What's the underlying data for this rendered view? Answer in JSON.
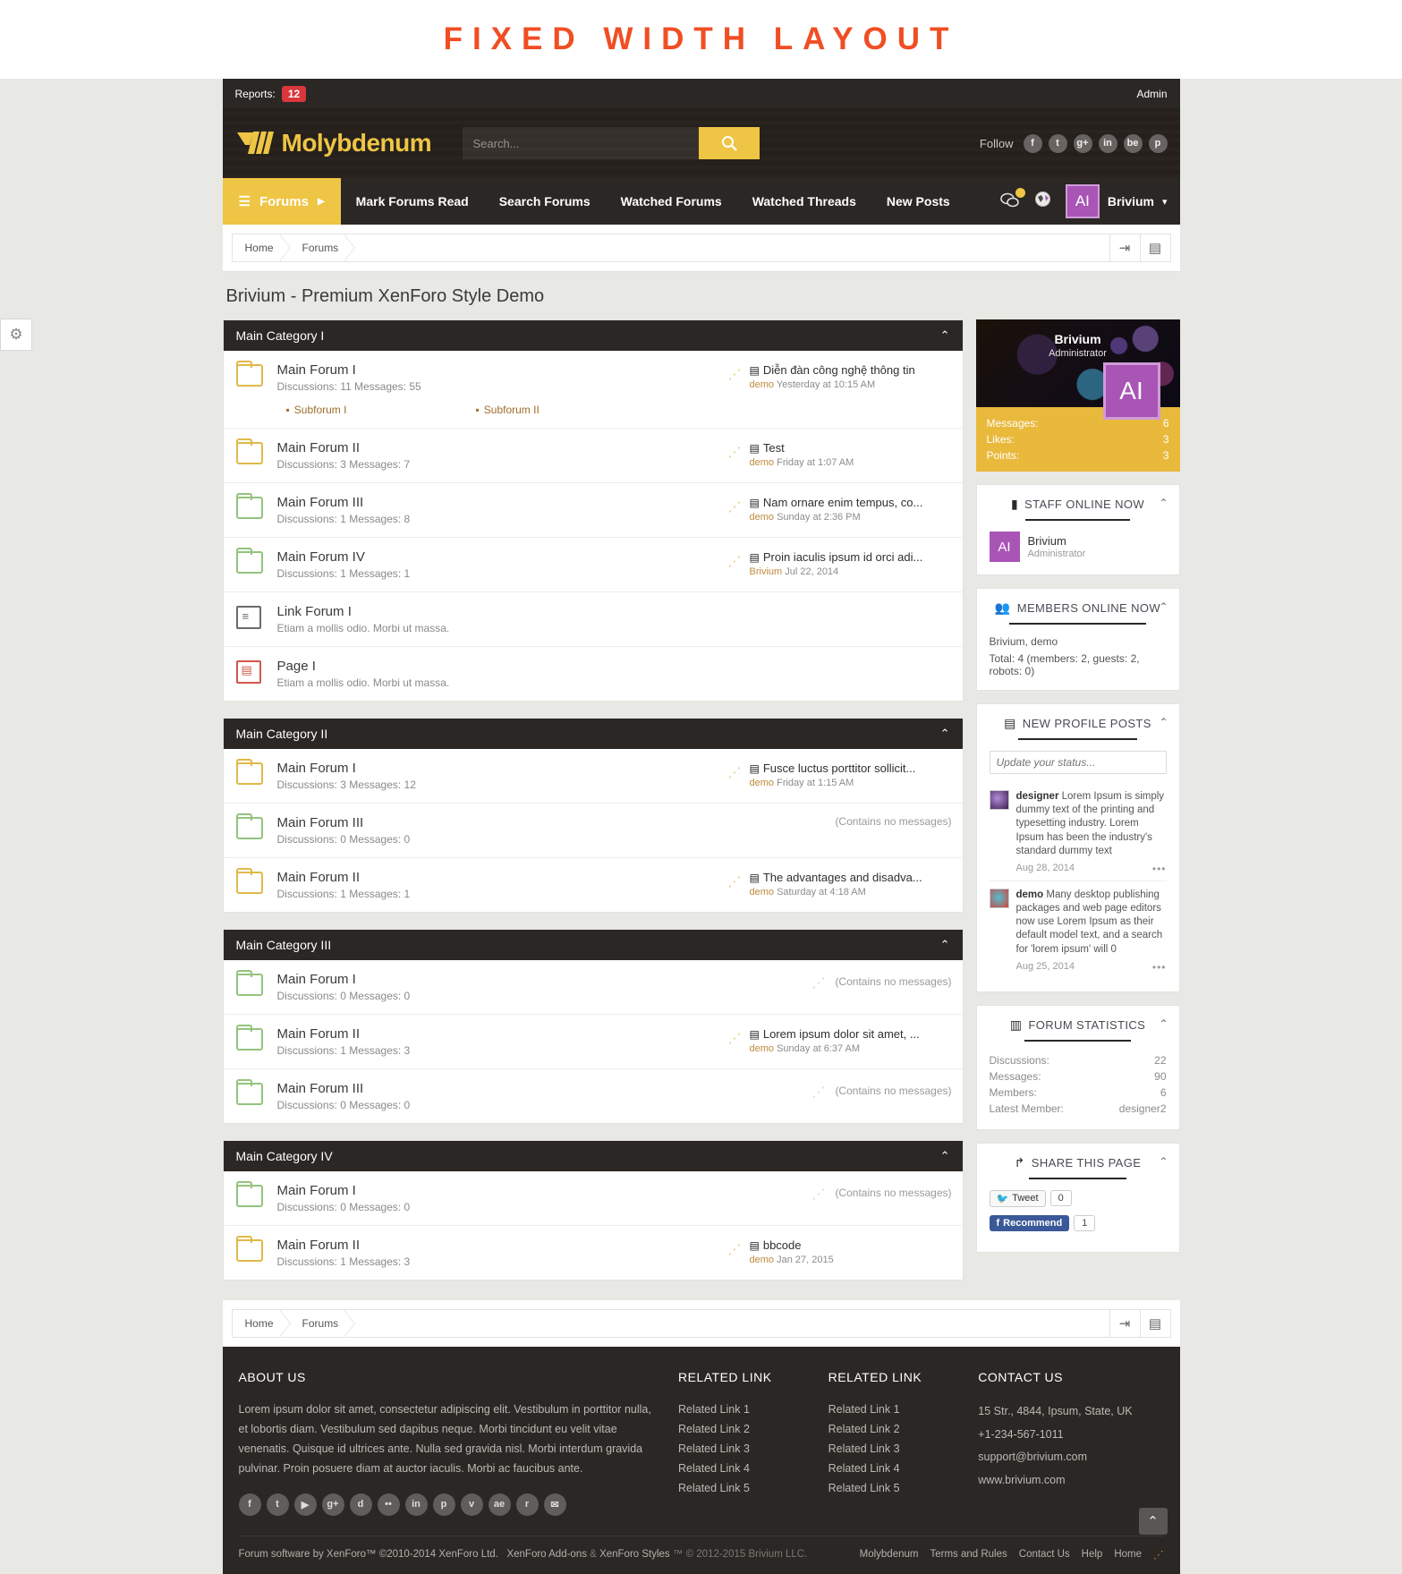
{
  "banner": {
    "text": "FIXED WIDTH LAYOUT"
  },
  "topbar": {
    "reports_label": "Reports:",
    "reports_count": "12",
    "admin": "Admin"
  },
  "header": {
    "logo_text": "Molybdenum",
    "search_placeholder": "Search...",
    "search_value": "",
    "follow_label": "Follow",
    "social": [
      "f",
      "t",
      "g+",
      "in",
      "be",
      "p"
    ]
  },
  "nav": {
    "home_label": "Forums",
    "items": [
      "Mark Forums Read",
      "Search Forums",
      "Watched Forums",
      "Watched Threads",
      "New Posts"
    ],
    "user_name": "Brivium",
    "user_initials": "AI"
  },
  "breadcrumb": {
    "items": [
      "Home",
      "Forums"
    ]
  },
  "page_title": "Brivium - Premium XenForo Style Demo",
  "categories": [
    {
      "name": "Main Category I",
      "forums": [
        {
          "icon": "folder-yellow",
          "title": "Main Forum I",
          "meta": "Discussions: 11 Messages: 55",
          "subforums": [
            "Subforum I",
            "Subforum II"
          ],
          "last_post": {
            "title": "Diễn đàn công nghệ thông tin",
            "user": "demo",
            "time": "Yesterday at 10:15 AM"
          }
        },
        {
          "icon": "folder-yellow",
          "title": "Main Forum II",
          "meta": "Discussions: 3 Messages: 7",
          "last_post": {
            "title": "Test",
            "user": "demo",
            "time": "Friday at 1:07 AM"
          }
        },
        {
          "icon": "folder-green",
          "title": "Main Forum III",
          "meta": "Discussions: 1 Messages: 8",
          "last_post": {
            "title": "Nam ornare enim tempus, co...",
            "user": "demo",
            "time": "Sunday at 2:36 PM"
          }
        },
        {
          "icon": "folder-green",
          "title": "Main Forum IV",
          "meta": "Discussions: 1 Messages: 1",
          "last_post": {
            "title": "Proin iaculis ipsum id orci adi...",
            "user": "Brivium",
            "time": "Jul 22, 2014"
          }
        },
        {
          "icon": "link",
          "title": "Link Forum I",
          "desc": "Etiam a mollis odio. Morbi ut massa."
        },
        {
          "icon": "page",
          "title": "Page I",
          "desc": "Etiam a mollis odio. Morbi ut massa."
        }
      ]
    },
    {
      "name": "Main Category II",
      "forums": [
        {
          "icon": "folder-yellow",
          "title": "Main Forum I",
          "meta": "Discussions: 3 Messages: 12",
          "last_post": {
            "title": "Fusce luctus porttitor sollicit...",
            "user": "demo",
            "time": "Friday at 1:15 AM"
          }
        },
        {
          "icon": "folder-green",
          "title": "Main Forum III",
          "meta": "Discussions: 0 Messages: 0",
          "empty": "(Contains no messages)"
        },
        {
          "icon": "folder-yellow",
          "title": "Main Forum II",
          "meta": "Discussions: 1 Messages: 1",
          "last_post": {
            "title": "The advantages and disadva...",
            "user": "demo",
            "time": "Saturday at 4:18 AM"
          }
        }
      ]
    },
    {
      "name": "Main Category III",
      "forums": [
        {
          "icon": "folder-green",
          "title": "Main Forum I",
          "meta": "Discussions: 0 Messages: 0",
          "empty": "(Contains no messages)"
        },
        {
          "icon": "folder-green",
          "title": "Main Forum II",
          "meta": "Discussions: 1 Messages: 3",
          "last_post": {
            "title": "Lorem ipsum dolor sit amet, ...",
            "user": "demo",
            "time": "Sunday at 6:37 AM"
          }
        },
        {
          "icon": "folder-green",
          "title": "Main Forum III",
          "meta": "Discussions: 0 Messages: 0",
          "empty": "(Contains no messages)"
        }
      ]
    },
    {
      "name": "Main Category IV",
      "forums": [
        {
          "icon": "folder-green",
          "title": "Main Forum I",
          "meta": "Discussions: 0 Messages: 0",
          "empty": "(Contains no messages)"
        },
        {
          "icon": "folder-yellow",
          "title": "Main Forum II",
          "meta": "Discussions: 1 Messages: 3",
          "last_post": {
            "title": "bbcode",
            "user": "demo",
            "time": "Jan 27, 2015"
          }
        }
      ]
    }
  ],
  "sidebar": {
    "visitor": {
      "name": "Brivium",
      "role": "Administrator",
      "initials": "AI",
      "stats": [
        {
          "label": "Messages:",
          "value": "6"
        },
        {
          "label": "Likes:",
          "value": "3"
        },
        {
          "label": "Points:",
          "value": "3"
        }
      ]
    },
    "staff_online": {
      "title": "STAFF ONLINE NOW",
      "members": [
        {
          "initials": "AI",
          "name": "Brivium",
          "role": "Administrator"
        }
      ]
    },
    "members_online": {
      "title": "MEMBERS ONLINE NOW",
      "names": "Brivium, demo",
      "total": "Total: 4 (members: 2, guests: 2, robots: 0)"
    },
    "profile_posts": {
      "title": "NEW PROFILE POSTS",
      "status_placeholder": "Update your status...",
      "items": [
        {
          "author": "designer",
          "text": "Lorem Ipsum is simply dummy text of the printing and typesetting industry. Lorem Ipsum has been the industry's standard dummy text",
          "date": "Aug 28, 2014"
        },
        {
          "author": "demo",
          "text": "Many desktop publishing packages and web page editors now use Lorem Ipsum as their default model text, and a search for 'lorem ipsum' will 0",
          "date": "Aug 25, 2014"
        }
      ]
    },
    "forum_statistics": {
      "title": "FORUM STATISTICS",
      "rows": [
        {
          "label": "Discussions:",
          "value": "22"
        },
        {
          "label": "Messages:",
          "value": "90"
        },
        {
          "label": "Members:",
          "value": "6"
        },
        {
          "label": "Latest Member:",
          "value": "designer2"
        }
      ]
    },
    "share": {
      "title": "SHARE THIS PAGE",
      "tweet_label": "Tweet",
      "tweet_count": "0",
      "fb_label": "Recommend",
      "fb_count": "1"
    }
  },
  "footer": {
    "about_title": "ABOUT US",
    "about_text": "Lorem ipsum dolor sit amet, consectetur adipiscing elit. Vestibulum in porttitor nulla, et lobortis diam. Vestibulum sed dapibus neque. Morbi tincidunt eu velit vitae venenatis. Quisque id ultrices ante. Nulla sed gravida nisl. Morbi interdum gravida pulvinar. Proin posuere diam at auctor iaculis. Morbi ac faucibus ante.",
    "socials": [
      "f",
      "t",
      "▶",
      "g+",
      "d",
      "••",
      "in",
      "p",
      "v",
      "ae",
      "r",
      "✉"
    ],
    "links_title_1": "RELATED LINK",
    "links_1": [
      "Related Link 1",
      "Related Link 2",
      "Related Link 3",
      "Related Link 4",
      "Related Link 5"
    ],
    "links_title_2": "RELATED LINK",
    "links_2": [
      "Related Link 1",
      "Related Link 2",
      "Related Link 3",
      "Related Link 4",
      "Related Link 5"
    ],
    "contact_title": "CONTACT US",
    "contact_lines": [
      "15 Str., 4844, Ipsum, State, UK",
      "+1-234-567-1011",
      "support@brivium.com",
      "www.brivium.com"
    ],
    "legal_left_1": "Forum software by XenForo™ ©2010-2014 XenForo Ltd.",
    "legal_left_2": "XenForo Add-ons",
    "legal_amp": "&",
    "legal_left_3": "XenForo Styles",
    "legal_left_4": "™ © 2012-2015 Brivium LLC.",
    "legal_links": [
      "Molybdenum",
      "Terms and Rules",
      "Contact Us",
      "Help",
      "Home"
    ]
  }
}
